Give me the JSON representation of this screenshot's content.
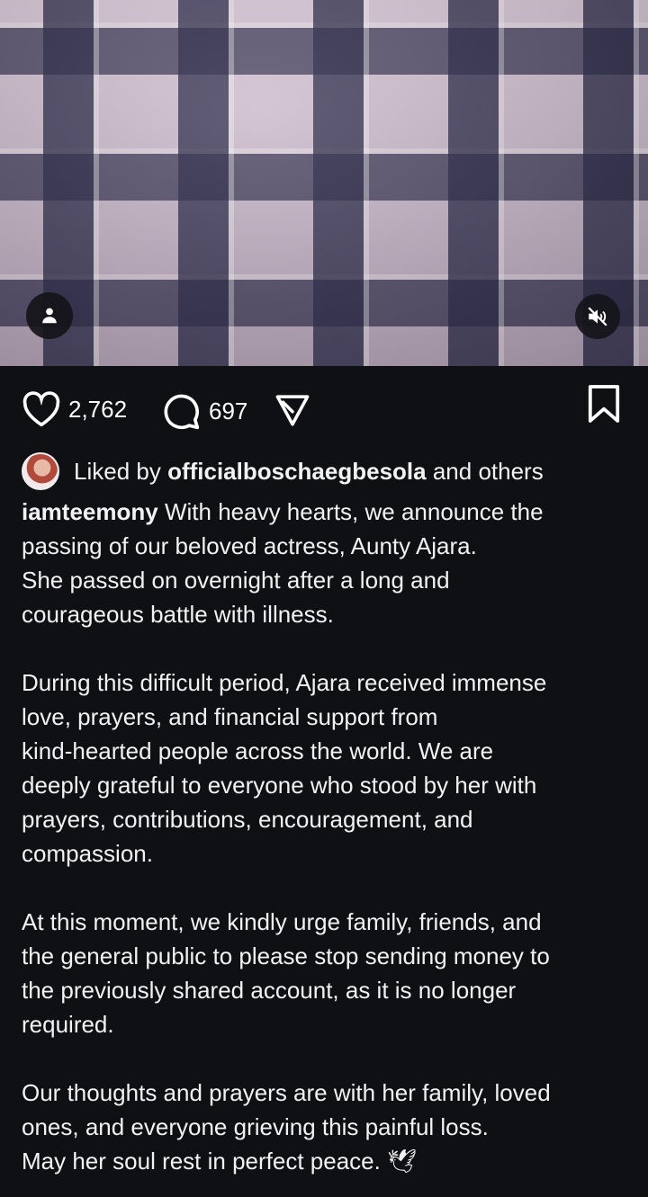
{
  "post": {
    "likes": "2,762",
    "comments": "697",
    "liked_by_prefix": "Liked by",
    "liked_by_user": "officialboschaegbesola",
    "liked_by_suffix": "and others",
    "username": "iamteemony",
    "caption_lines": [
      "With heavy hearts, we announce the",
      "passing of our beloved actress, Aunty Ajara.",
      "She passed on overnight after a long and",
      "courageous battle with illness.",
      "",
      "During this difficult period, Ajara received immense",
      "love, prayers, and financial support from",
      "kind-hearted people across the world. We are",
      "deeply grateful to everyone who stood by her with",
      "prayers, contributions, encouragement, and",
      "compassion.",
      "",
      "At this moment, we kindly urge family, friends, and",
      "the general public to please stop sending money to",
      "the previously shared account, as it is no longer",
      "required.",
      "",
      "Our thoughts and prayers are with her family, loved",
      "ones, and everyone grieving this painful loss.",
      "May her soul rest in perfect peace."
    ],
    "emoji": "🕊"
  },
  "icons": {
    "tag": "person-icon",
    "mute": "speaker-muted-icon",
    "like": "heart-icon",
    "comment": "comment-bubble-icon",
    "share": "send-icon",
    "save": "bookmark-icon"
  }
}
